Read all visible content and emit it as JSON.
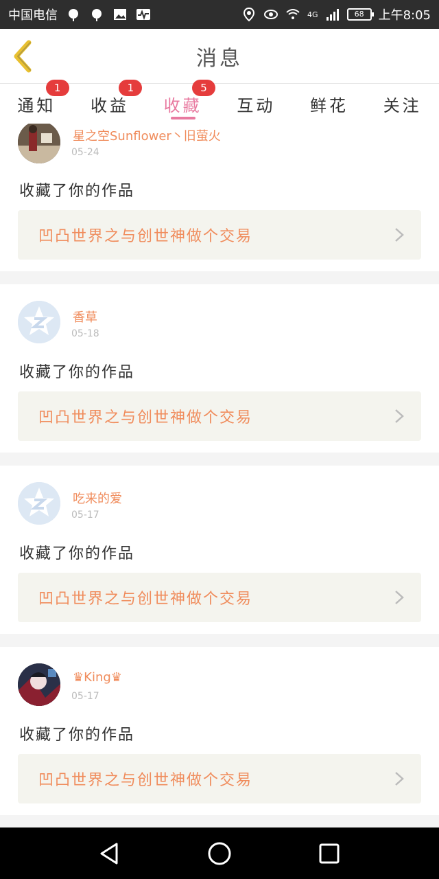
{
  "status_bar": {
    "carrier": "中国电信",
    "network": "4G",
    "battery": "68",
    "time": "上午8:05"
  },
  "header": {
    "title": "消息"
  },
  "tabs": [
    {
      "label": "通知",
      "badge": "1"
    },
    {
      "label": "收益",
      "badge": "1"
    },
    {
      "label": "收藏",
      "badge": "5",
      "active": true
    },
    {
      "label": "互动",
      "badge": ""
    },
    {
      "label": "鲜花",
      "badge": ""
    },
    {
      "label": "关注",
      "badge": ""
    }
  ],
  "items": [
    {
      "user": "星之空Sunflower丶旧萤火",
      "date": "05-24",
      "action": "收藏了你的作品",
      "work": "凹凸世界之与创世神做个交易"
    },
    {
      "user": "香草",
      "date": "05-18",
      "action": "收藏了你的作品",
      "work": "凹凸世界之与创世神做个交易"
    },
    {
      "user": "吃来的爱",
      "date": "05-17",
      "action": "收藏了你的作品",
      "work": "凹凸世界之与创世神做个交易"
    },
    {
      "user": "♛King♛",
      "date": "05-17",
      "action": "收藏了你的作品",
      "work": "凹凸世界之与创世神做个交易"
    }
  ],
  "colors": {
    "accent": "#e87aa0",
    "name": "#f08c5c",
    "badge": "#e53c3c",
    "back_arrow": "#e8c030"
  }
}
